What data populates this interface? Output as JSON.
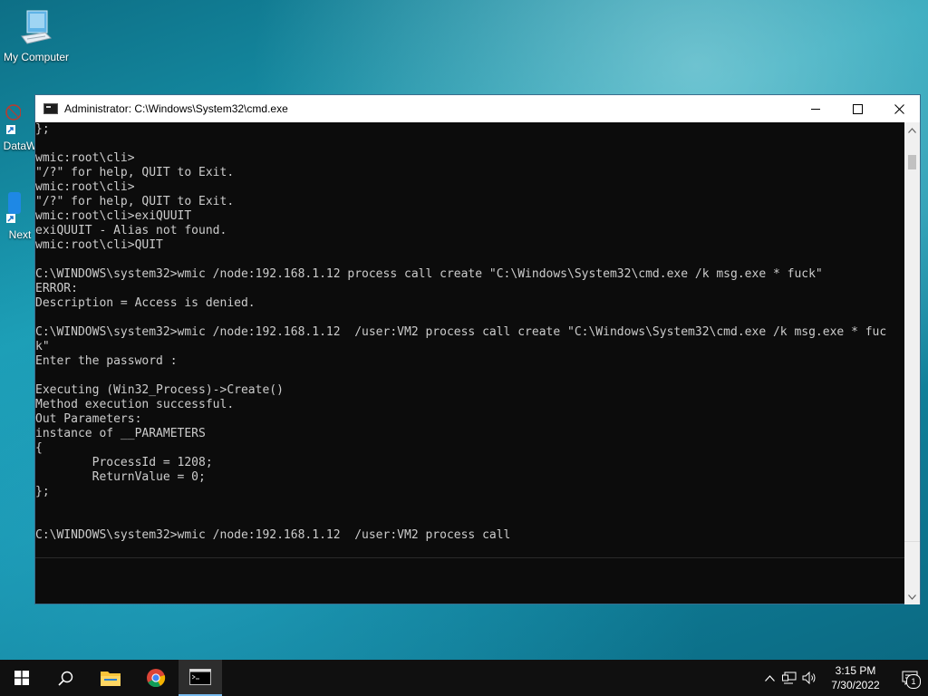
{
  "desktop": {
    "icons": [
      {
        "label": "My Computer"
      },
      {
        "label": "DataW"
      },
      {
        "label": "Next"
      }
    ]
  },
  "window": {
    "title": "Administrator: C:\\Windows\\System32\\cmd.exe",
    "minimize_symbol": "—",
    "maximize_symbol": "☐",
    "close_symbol": "✕"
  },
  "console": {
    "lines": [
      "};",
      "",
      "wmic:root\\cli>",
      "\"/?\" for help, QUIT to Exit.",
      "wmic:root\\cli>",
      "\"/?\" for help, QUIT to Exit.",
      "wmic:root\\cli>exiQUUIT",
      "exiQUUIT - Alias not found.",
      "wmic:root\\cli>QUIT",
      "",
      "C:\\WINDOWS\\system32>wmic /node:192.168.1.12 process call create \"C:\\Windows\\System32\\cmd.exe /k msg.exe * fuck\"",
      "ERROR:",
      "Description = Access is denied.",
      "",
      "C:\\WINDOWS\\system32>wmic /node:192.168.1.12  /user:VM2 process call create \"C:\\Windows\\System32\\cmd.exe /k msg.exe * fuc",
      "k\"",
      "Enter the password :",
      "",
      "Executing (Win32_Process)->Create()",
      "Method execution successful.",
      "Out Parameters:",
      "instance of __PARAMETERS",
      "{",
      "        ProcessId = 1208;",
      "        ReturnValue = 0;",
      "};",
      "",
      "",
      "C:\\WINDOWS\\system32>wmic /node:192.168.1.12  /user:VM2 process call"
    ]
  },
  "taskbar": {
    "time": "3:15 PM",
    "date": "7/30/2022",
    "notification_count": "1"
  },
  "colors": {
    "console_bg": "#0c0c0c",
    "console_fg": "#cccccc",
    "taskbar_bg": "#101010",
    "accent": "#76b9ed"
  }
}
